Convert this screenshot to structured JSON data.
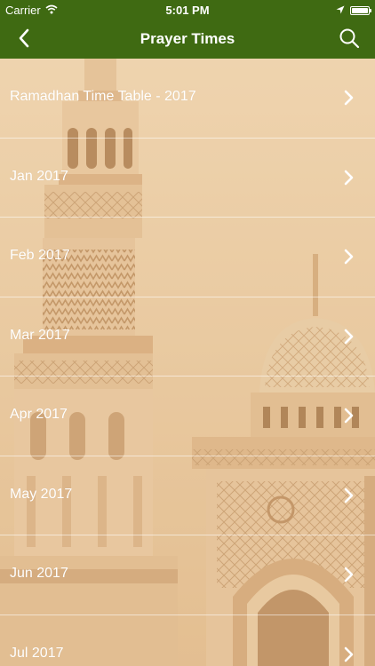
{
  "status_bar": {
    "carrier": "Carrier",
    "time": "5:01 PM",
    "icons": [
      "wifi-icon",
      "location-arrow-icon",
      "battery-icon"
    ]
  },
  "nav": {
    "title": "Prayer Times",
    "back_icon": "chevron-left-icon",
    "search_icon": "search-icon"
  },
  "colors": {
    "nav_background": "#3f6a12",
    "list_text": "#ffffff",
    "background_tint": "#e8c9a0"
  },
  "list": {
    "items": [
      {
        "label": "Ramadhan Time Table - 2017"
      },
      {
        "label": "Jan 2017"
      },
      {
        "label": "Feb 2017"
      },
      {
        "label": "Mar 2017"
      },
      {
        "label": "Apr 2017"
      },
      {
        "label": "May 2017"
      },
      {
        "label": "Jun 2017"
      },
      {
        "label": "Jul 2017"
      }
    ]
  }
}
